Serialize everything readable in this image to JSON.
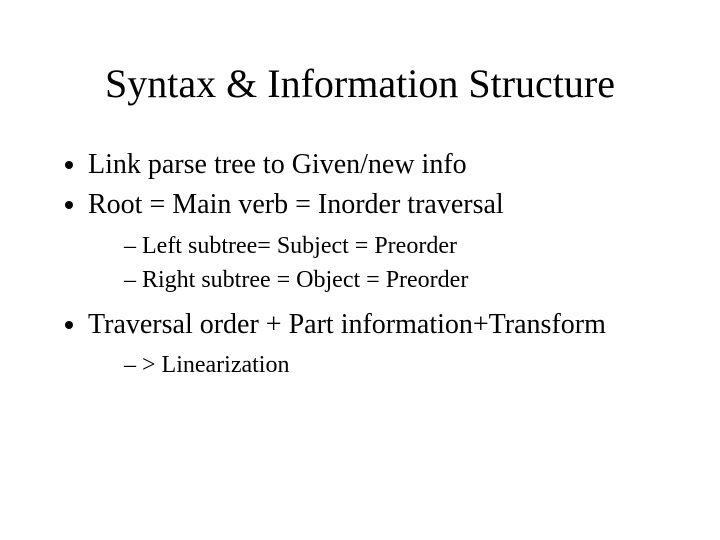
{
  "title": "Syntax & Information Structure",
  "bullets": [
    {
      "text": "Link parse tree to Given/new info"
    },
    {
      "text": "Root = Main verb = Inorder traversal",
      "sub": [
        "Left subtree= Subject = Preorder",
        "Right subtree = Object = Preorder"
      ]
    },
    {
      "text": "Traversal order + Part information+Transform",
      "sub": [
        "> Linearization"
      ]
    }
  ]
}
